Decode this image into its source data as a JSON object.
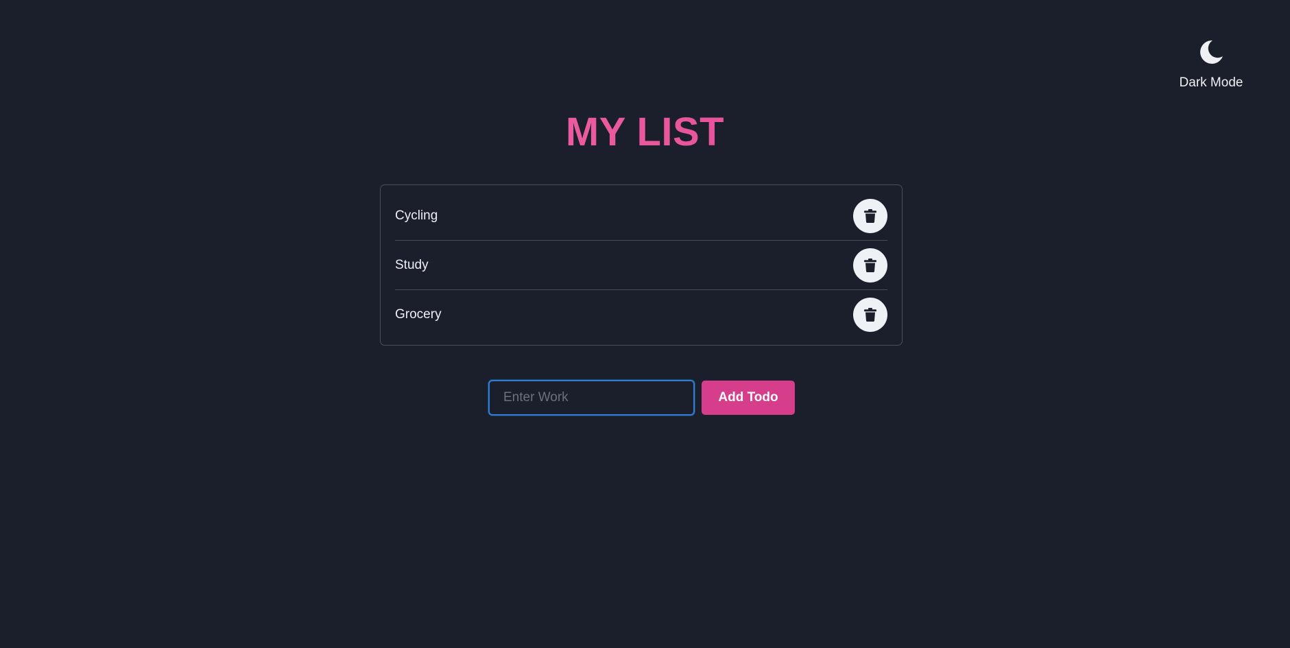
{
  "theme_toggle": {
    "icon": "moon-icon",
    "label": "Dark Mode"
  },
  "title": "MY LIST",
  "todos": [
    {
      "text": "Cycling",
      "delete_icon": "trash-icon"
    },
    {
      "text": "Study",
      "delete_icon": "trash-icon"
    },
    {
      "text": "Grocery",
      "delete_icon": "trash-icon"
    }
  ],
  "add_form": {
    "input_value": "",
    "input_placeholder": "Enter Work",
    "button_label": "Add Todo"
  },
  "colors": {
    "background": "#1b1f2b",
    "title_gradient_start": "#f07aae",
    "title_gradient_end": "#d63b87",
    "accent": "#d63d8a",
    "input_focus_border": "#2f7fd6",
    "delete_button_bg": "#eef1f5"
  }
}
